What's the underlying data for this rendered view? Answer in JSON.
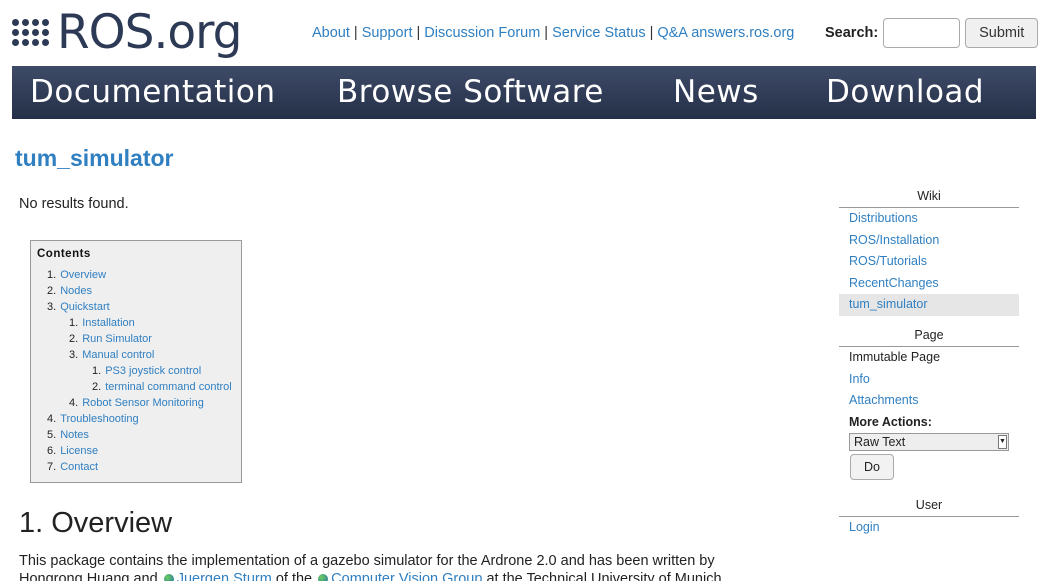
{
  "logo": {
    "text": "ROS.org"
  },
  "top_links": [
    "About",
    "Support",
    "Discussion Forum",
    "Service Status",
    "Q&A answers.ros.org"
  ],
  "search": {
    "label": "Search:",
    "placeholder": "",
    "submit_label": "Submit"
  },
  "nav": [
    "Documentation",
    "Browse Software",
    "News",
    "Download"
  ],
  "page": {
    "title": "tum_simulator",
    "no_results": "No results found.",
    "toc": {
      "title": "Contents",
      "items": [
        {
          "num": "1.",
          "label": "Overview"
        },
        {
          "num": "2.",
          "label": "Nodes"
        },
        {
          "num": "3.",
          "label": "Quickstart"
        },
        {
          "num": "1.",
          "label": "Installation"
        },
        {
          "num": "2.",
          "label": "Run Simulator"
        },
        {
          "num": "3.",
          "label": "Manual control"
        },
        {
          "num": "1.",
          "label": "PS3 joystick control"
        },
        {
          "num": "2.",
          "label": "terminal command control"
        },
        {
          "num": "4.",
          "label": "Robot Sensor Monitoring"
        },
        {
          "num": "4.",
          "label": "Troubleshooting"
        },
        {
          "num": "5.",
          "label": "Notes"
        },
        {
          "num": "6.",
          "label": "License"
        },
        {
          "num": "7.",
          "label": "Contact"
        }
      ]
    },
    "section_heading": "1. Overview",
    "paragraph": {
      "text1": "This package contains the implementation of a gazebo simulator for the Ardrone 2.0 and has been written by Hongrong Huang and",
      "link1": "Juergen Sturm",
      "text2": "of the",
      "link2": "Computer Vision Group",
      "text3": "at the Technical University of Munich."
    }
  },
  "sidebar": {
    "wiki": {
      "heading": "Wiki",
      "items": [
        "Distributions",
        "ROS/Installation",
        "ROS/Tutorials",
        "RecentChanges",
        "tum_simulator"
      ]
    },
    "page": {
      "heading": "Page",
      "immutable": "Immutable Page",
      "info": "Info",
      "attachments": "Attachments",
      "more_actions": "More Actions:",
      "select_value": "Raw Text",
      "do_label": "Do"
    },
    "user": {
      "heading": "User",
      "login": "Login"
    }
  }
}
